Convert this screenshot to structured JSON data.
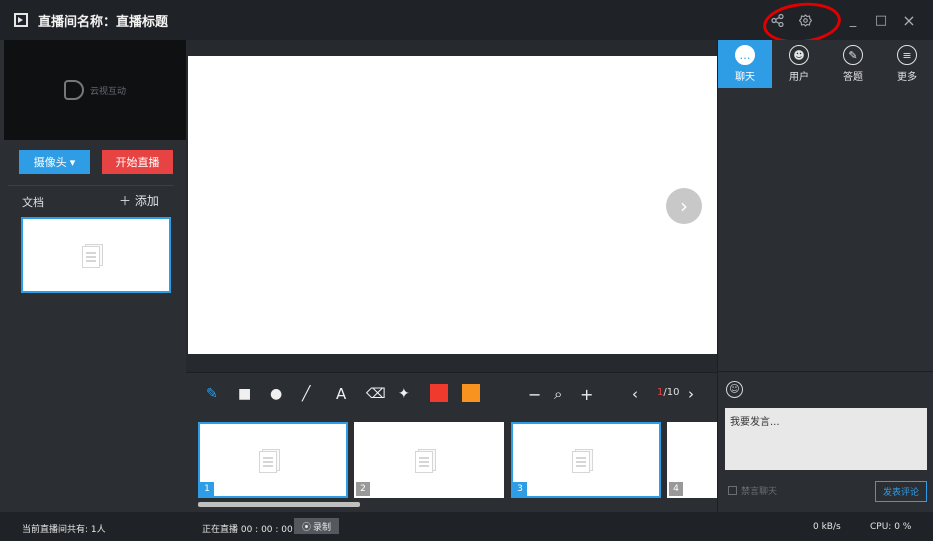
{
  "window": {
    "title": "直播间名称：直播标题",
    "controls": {
      "share": "share-icon",
      "settings": "settings-icon",
      "minimize": "_",
      "maximize": "□",
      "close": "×"
    }
  },
  "left_panel": {
    "preview_logo_text": "云视互动",
    "camera_label": "摄像头",
    "camera_caret": "▾",
    "start_label": "开始直播",
    "docs_label": "文档",
    "add_label": "＋ 添加"
  },
  "center": {
    "next_symbol": "›",
    "tools": {
      "pen": "✎",
      "rect": "■",
      "circle": "●",
      "line": "╱",
      "text": "A",
      "eraser": "⌫",
      "clear": "✦",
      "zoom_out": "−",
      "zoom": "⌕",
      "zoom_in": "+",
      "prev": "‹",
      "next": "›"
    },
    "colors": {
      "red": "#f03a2e",
      "orange": "#f7931e"
    },
    "page": {
      "current": "1",
      "total": "/10"
    },
    "thumbnails": [
      {
        "num": "1",
        "selected": true
      },
      {
        "num": "2",
        "selected": false
      },
      {
        "num": "3",
        "selected": true
      },
      {
        "num": "4",
        "selected": false
      }
    ]
  },
  "right_panel": {
    "tabs": [
      {
        "label": "聊天",
        "icon": "chat-icon",
        "glyph": "…"
      },
      {
        "label": "用户",
        "icon": "users-icon",
        "glyph": "☻"
      },
      {
        "label": "答题",
        "icon": "pencil-icon",
        "glyph": "✎"
      },
      {
        "label": "更多",
        "icon": "list-icon",
        "glyph": "≡"
      }
    ],
    "emoji_glyph": "☺",
    "input_placeholder": "我要发言...",
    "mute_label": "禁言聊天",
    "send_label": "发表评论"
  },
  "statusbar": {
    "viewer_count": "当前直播间共有: 1人",
    "live_status": "正在直播 00 : 00 : 00",
    "record_label": "录制",
    "bandwidth": "0 kB/s",
    "cpu": "CPU:  0 %"
  }
}
